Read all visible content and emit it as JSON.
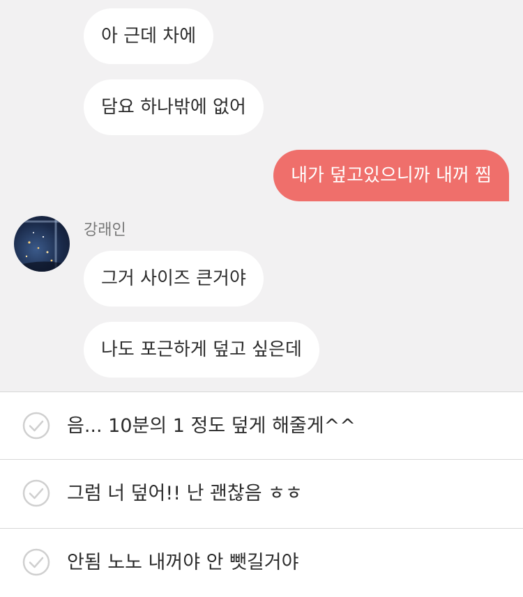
{
  "chat": {
    "messages": [
      {
        "side": "incoming",
        "text": "아 근데 차에"
      },
      {
        "side": "incoming",
        "text": "담요 하나밖에 없어"
      },
      {
        "side": "outgoing",
        "text": "내가 덮고있으니까 내꺼 찜"
      },
      {
        "side": "incoming",
        "text": "그거 사이즈 큰거야"
      },
      {
        "side": "incoming",
        "text": "나도 포근하게 덮고 싶은데"
      }
    ],
    "sender_name": "강래인"
  },
  "choices": [
    {
      "label": "음... 10분의 1 정도 덮게 해줄게^^"
    },
    {
      "label": "그럼 너 덮어!! 난 괜찮음 ㅎㅎ"
    },
    {
      "label": "안됨 노노 내꺼야 안 뺏길거야"
    }
  ],
  "colors": {
    "outgoing_bubble": "#ef6f6b",
    "incoming_bubble": "#ffffff",
    "chat_background": "#f2f1f2"
  },
  "icons": {
    "choice_icon": "check-circle-icon"
  }
}
